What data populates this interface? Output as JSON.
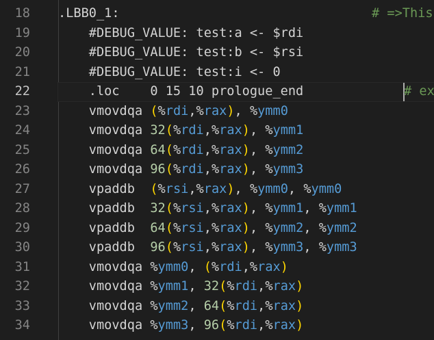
{
  "editor": {
    "lines": [
      {
        "num": "18",
        "tokens": [
          {
            "t": ".LBB0_1:",
            "c": "k"
          }
        ],
        "comment": "# =>This"
      },
      {
        "num": "19",
        "tokens": [
          {
            "t": "    #DEBUG_VALUE: test:a <- $rdi",
            "c": "k"
          }
        ]
      },
      {
        "num": "20",
        "tokens": [
          {
            "t": "    #DEBUG_VALUE: test:b <- $rsi",
            "c": "k"
          }
        ]
      },
      {
        "num": "21",
        "tokens": [
          {
            "t": "    #DEBUG_VALUE: test:i <- 0",
            "c": "k"
          }
        ]
      },
      {
        "num": "22",
        "current": true,
        "tokens": [
          {
            "t": "    .loc    0 15 10 prologue_end",
            "c": "k"
          }
        ],
        "comment": "# ex"
      },
      {
        "num": "23",
        "tokens": [
          {
            "t": "    vmovdqa ",
            "c": "k"
          },
          {
            "t": "(",
            "c": "p"
          },
          {
            "t": "%",
            "c": "k"
          },
          {
            "t": "rdi",
            "c": "r"
          },
          {
            "t": ",",
            "c": "k"
          },
          {
            "t": "%",
            "c": "k"
          },
          {
            "t": "rax",
            "c": "r"
          },
          {
            "t": ")",
            "c": "p"
          },
          {
            "t": ", ",
            "c": "k"
          },
          {
            "t": "%",
            "c": "k"
          },
          {
            "t": "ymm0",
            "c": "r"
          }
        ]
      },
      {
        "num": "24",
        "tokens": [
          {
            "t": "    vmovdqa ",
            "c": "k"
          },
          {
            "t": "32",
            "c": "n"
          },
          {
            "t": "(",
            "c": "p"
          },
          {
            "t": "%",
            "c": "k"
          },
          {
            "t": "rdi",
            "c": "r"
          },
          {
            "t": ",",
            "c": "k"
          },
          {
            "t": "%",
            "c": "k"
          },
          {
            "t": "rax",
            "c": "r"
          },
          {
            "t": ")",
            "c": "p"
          },
          {
            "t": ", ",
            "c": "k"
          },
          {
            "t": "%",
            "c": "k"
          },
          {
            "t": "ymm1",
            "c": "r"
          }
        ]
      },
      {
        "num": "25",
        "tokens": [
          {
            "t": "    vmovdqa ",
            "c": "k"
          },
          {
            "t": "64",
            "c": "n"
          },
          {
            "t": "(",
            "c": "p"
          },
          {
            "t": "%",
            "c": "k"
          },
          {
            "t": "rdi",
            "c": "r"
          },
          {
            "t": ",",
            "c": "k"
          },
          {
            "t": "%",
            "c": "k"
          },
          {
            "t": "rax",
            "c": "r"
          },
          {
            "t": ")",
            "c": "p"
          },
          {
            "t": ", ",
            "c": "k"
          },
          {
            "t": "%",
            "c": "k"
          },
          {
            "t": "ymm2",
            "c": "r"
          }
        ]
      },
      {
        "num": "26",
        "tokens": [
          {
            "t": "    vmovdqa ",
            "c": "k"
          },
          {
            "t": "96",
            "c": "n"
          },
          {
            "t": "(",
            "c": "p"
          },
          {
            "t": "%",
            "c": "k"
          },
          {
            "t": "rdi",
            "c": "r"
          },
          {
            "t": ",",
            "c": "k"
          },
          {
            "t": "%",
            "c": "k"
          },
          {
            "t": "rax",
            "c": "r"
          },
          {
            "t": ")",
            "c": "p"
          },
          {
            "t": ", ",
            "c": "k"
          },
          {
            "t": "%",
            "c": "k"
          },
          {
            "t": "ymm3",
            "c": "r"
          }
        ]
      },
      {
        "num": "27",
        "tokens": [
          {
            "t": "    vpaddb  ",
            "c": "k"
          },
          {
            "t": "(",
            "c": "p"
          },
          {
            "t": "%",
            "c": "k"
          },
          {
            "t": "rsi",
            "c": "r"
          },
          {
            "t": ",",
            "c": "k"
          },
          {
            "t": "%",
            "c": "k"
          },
          {
            "t": "rax",
            "c": "r"
          },
          {
            "t": ")",
            "c": "p"
          },
          {
            "t": ", ",
            "c": "k"
          },
          {
            "t": "%",
            "c": "k"
          },
          {
            "t": "ymm0",
            "c": "r"
          },
          {
            "t": ", ",
            "c": "k"
          },
          {
            "t": "%",
            "c": "k"
          },
          {
            "t": "ymm0",
            "c": "r"
          }
        ]
      },
      {
        "num": "28",
        "tokens": [
          {
            "t": "    vpaddb  ",
            "c": "k"
          },
          {
            "t": "32",
            "c": "n"
          },
          {
            "t": "(",
            "c": "p"
          },
          {
            "t": "%",
            "c": "k"
          },
          {
            "t": "rsi",
            "c": "r"
          },
          {
            "t": ",",
            "c": "k"
          },
          {
            "t": "%",
            "c": "k"
          },
          {
            "t": "rax",
            "c": "r"
          },
          {
            "t": ")",
            "c": "p"
          },
          {
            "t": ", ",
            "c": "k"
          },
          {
            "t": "%",
            "c": "k"
          },
          {
            "t": "ymm1",
            "c": "r"
          },
          {
            "t": ", ",
            "c": "k"
          },
          {
            "t": "%",
            "c": "k"
          },
          {
            "t": "ymm1",
            "c": "r"
          }
        ]
      },
      {
        "num": "29",
        "tokens": [
          {
            "t": "    vpaddb  ",
            "c": "k"
          },
          {
            "t": "64",
            "c": "n"
          },
          {
            "t": "(",
            "c": "p"
          },
          {
            "t": "%",
            "c": "k"
          },
          {
            "t": "rsi",
            "c": "r"
          },
          {
            "t": ",",
            "c": "k"
          },
          {
            "t": "%",
            "c": "k"
          },
          {
            "t": "rax",
            "c": "r"
          },
          {
            "t": ")",
            "c": "p"
          },
          {
            "t": ", ",
            "c": "k"
          },
          {
            "t": "%",
            "c": "k"
          },
          {
            "t": "ymm2",
            "c": "r"
          },
          {
            "t": ", ",
            "c": "k"
          },
          {
            "t": "%",
            "c": "k"
          },
          {
            "t": "ymm2",
            "c": "r"
          }
        ]
      },
      {
        "num": "30",
        "tokens": [
          {
            "t": "    vpaddb  ",
            "c": "k"
          },
          {
            "t": "96",
            "c": "n"
          },
          {
            "t": "(",
            "c": "p"
          },
          {
            "t": "%",
            "c": "k"
          },
          {
            "t": "rsi",
            "c": "r"
          },
          {
            "t": ",",
            "c": "k"
          },
          {
            "t": "%",
            "c": "k"
          },
          {
            "t": "rax",
            "c": "r"
          },
          {
            "t": ")",
            "c": "p"
          },
          {
            "t": ", ",
            "c": "k"
          },
          {
            "t": "%",
            "c": "k"
          },
          {
            "t": "ymm3",
            "c": "r"
          },
          {
            "t": ", ",
            "c": "k"
          },
          {
            "t": "%",
            "c": "k"
          },
          {
            "t": "ymm3",
            "c": "r"
          }
        ]
      },
      {
        "num": "31",
        "tokens": [
          {
            "t": "    vmovdqa ",
            "c": "k"
          },
          {
            "t": "%",
            "c": "k"
          },
          {
            "t": "ymm0",
            "c": "r"
          },
          {
            "t": ", ",
            "c": "k"
          },
          {
            "t": "(",
            "c": "p"
          },
          {
            "t": "%",
            "c": "k"
          },
          {
            "t": "rdi",
            "c": "r"
          },
          {
            "t": ",",
            "c": "k"
          },
          {
            "t": "%",
            "c": "k"
          },
          {
            "t": "rax",
            "c": "r"
          },
          {
            "t": ")",
            "c": "p"
          }
        ]
      },
      {
        "num": "32",
        "tokens": [
          {
            "t": "    vmovdqa ",
            "c": "k"
          },
          {
            "t": "%",
            "c": "k"
          },
          {
            "t": "ymm1",
            "c": "r"
          },
          {
            "t": ", ",
            "c": "k"
          },
          {
            "t": "32",
            "c": "n"
          },
          {
            "t": "(",
            "c": "p"
          },
          {
            "t": "%",
            "c": "k"
          },
          {
            "t": "rdi",
            "c": "r"
          },
          {
            "t": ",",
            "c": "k"
          },
          {
            "t": "%",
            "c": "k"
          },
          {
            "t": "rax",
            "c": "r"
          },
          {
            "t": ")",
            "c": "p"
          }
        ]
      },
      {
        "num": "33",
        "tokens": [
          {
            "t": "    vmovdqa ",
            "c": "k"
          },
          {
            "t": "%",
            "c": "k"
          },
          {
            "t": "ymm2",
            "c": "r"
          },
          {
            "t": ", ",
            "c": "k"
          },
          {
            "t": "64",
            "c": "n"
          },
          {
            "t": "(",
            "c": "p"
          },
          {
            "t": "%",
            "c": "k"
          },
          {
            "t": "rdi",
            "c": "r"
          },
          {
            "t": ",",
            "c": "k"
          },
          {
            "t": "%",
            "c": "k"
          },
          {
            "t": "rax",
            "c": "r"
          },
          {
            "t": ")",
            "c": "p"
          }
        ]
      },
      {
        "num": "34",
        "tokens": [
          {
            "t": "    vmovdqa ",
            "c": "k"
          },
          {
            "t": "%",
            "c": "k"
          },
          {
            "t": "ymm3",
            "c": "r"
          },
          {
            "t": ", ",
            "c": "k"
          },
          {
            "t": "96",
            "c": "n"
          },
          {
            "t": "(",
            "c": "p"
          },
          {
            "t": "%",
            "c": "k"
          },
          {
            "t": "rdi",
            "c": "r"
          },
          {
            "t": ",",
            "c": "k"
          },
          {
            "t": "%",
            "c": "k"
          },
          {
            "t": "rax",
            "c": "r"
          },
          {
            "t": ")",
            "c": "p"
          }
        ]
      }
    ]
  },
  "colors": {
    "background": "#1e1e1e",
    "text": "#d4d4d4",
    "gutter": "#858585",
    "paren": "#ffd700",
    "register": "#569cd6",
    "number": "#b5cea8",
    "comment": "#6a9955"
  }
}
